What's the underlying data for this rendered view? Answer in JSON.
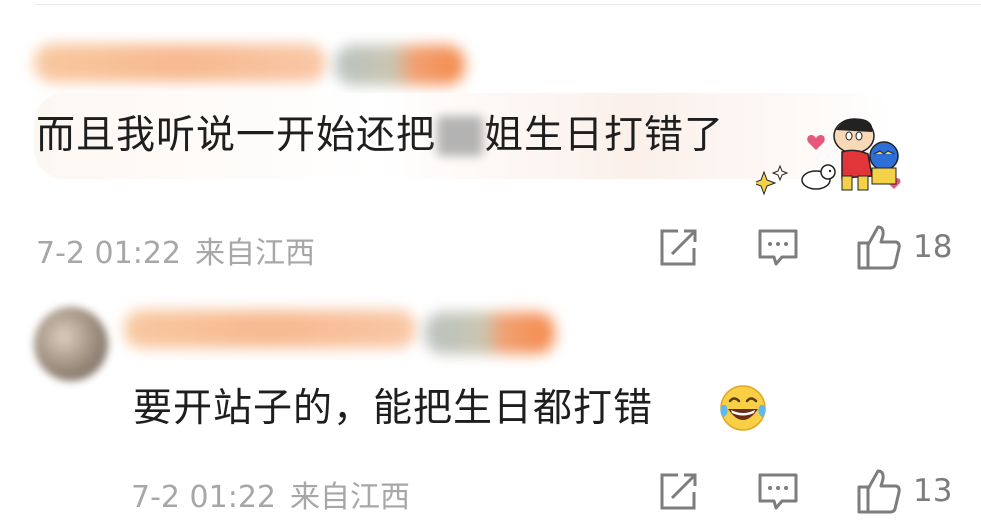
{
  "comments": [
    {
      "text_before": "而且我听说一开始还把",
      "text_after": "姐生日打错了",
      "sticker_icon": "crayon-shinchan-sticker",
      "time": "7-2 01:22",
      "location": "来自江西",
      "likes": "18"
    },
    {
      "text_before": "要开站子的，能把生日都打错",
      "emoji_icon": "tears-of-joy-emoji",
      "time": "7-2 01:22",
      "location": "来自江西",
      "likes": "13"
    }
  ],
  "icons": {
    "share": "share-edit-icon",
    "reply": "comment-icon",
    "like": "thumbs-up-icon"
  },
  "colors": {
    "text": "#1e1e1e",
    "meta": "#a7a7a7",
    "icon": "#7d7d7d"
  }
}
